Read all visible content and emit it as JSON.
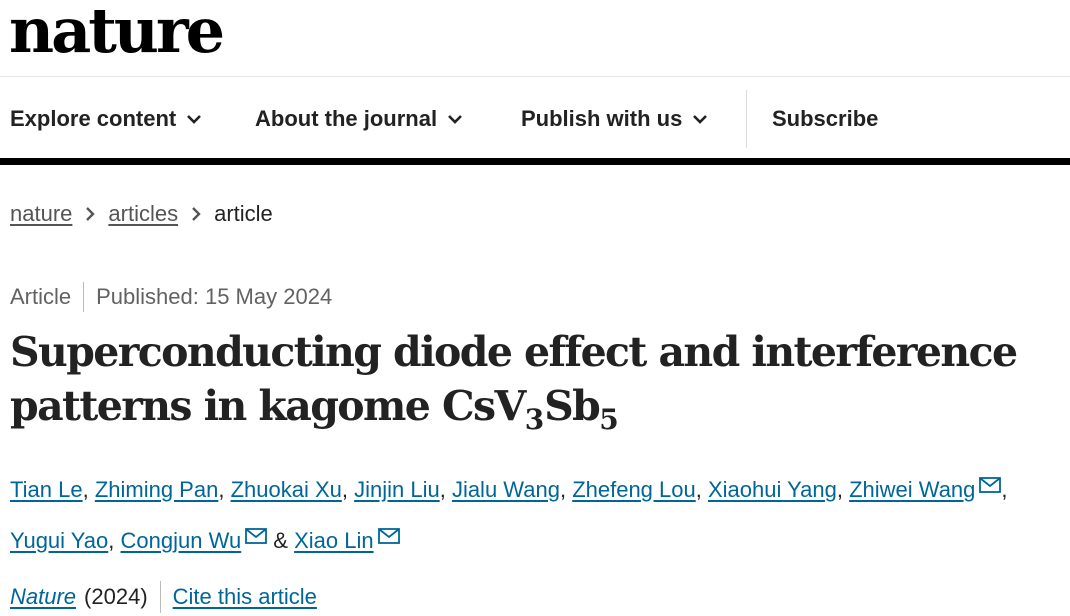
{
  "logo": "nature",
  "nav": {
    "items": [
      {
        "label": "Explore content"
      },
      {
        "label": "About the journal"
      },
      {
        "label": "Publish with us"
      }
    ],
    "subscribe": "Subscribe"
  },
  "breadcrumb": {
    "home": "nature",
    "section": "articles",
    "current": "article"
  },
  "meta": {
    "type": "Article",
    "published": "Published: 15 May 2024"
  },
  "title": {
    "line1": "Superconducting diode effect and interference",
    "line2_prefix": "patterns in kagome CsV",
    "sub1": "3",
    "mid": "Sb",
    "sub2": "5"
  },
  "authors": [
    {
      "name": "Tian Le",
      "mail": false
    },
    {
      "name": "Zhiming Pan",
      "mail": false
    },
    {
      "name": "Zhuokai Xu",
      "mail": false
    },
    {
      "name": "Jinjin Liu",
      "mail": false
    },
    {
      "name": "Jialu Wang",
      "mail": false
    },
    {
      "name": "Zhefeng Lou",
      "mail": false
    },
    {
      "name": "Xiaohui Yang",
      "mail": false
    },
    {
      "name": "Zhiwei Wang",
      "mail": true
    },
    {
      "name": "Yugui Yao",
      "mail": false
    },
    {
      "name": "Congjun Wu",
      "mail": true
    },
    {
      "name": "Xiao Lin",
      "mail": true
    }
  ],
  "citation": {
    "journal": "Nature",
    "year": "(2024)",
    "cite": "Cite this article"
  },
  "icons": {
    "chevron": "chevron-down-icon",
    "breadcrumb_sep": "chevron-right-icon",
    "mail": "mail-icon"
  },
  "colors": {
    "link": "#006699",
    "text": "#222222",
    "muted": "#626262"
  }
}
